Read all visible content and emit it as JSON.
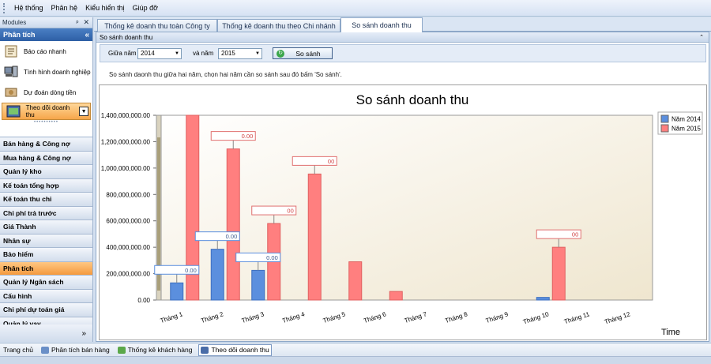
{
  "menu": [
    "Hệ thống",
    "Phân hệ",
    "Kiểu hiển thị",
    "Giúp đỡ"
  ],
  "modules": {
    "title": "Modules",
    "pin": "ᵖ",
    "close": "✕",
    "section": "Phân tích",
    "collapse": "«",
    "items": [
      {
        "label": "Báo cáo nhanh",
        "icon": "report-icon"
      },
      {
        "label": "Tình hình doanh nghiệp",
        "icon": "computer-icon"
      },
      {
        "label": "Dự đoán dòng tiền",
        "icon": "money-icon"
      },
      {
        "label": "Theo dõi doanh thu",
        "icon": "revenue-icon",
        "selected": true
      }
    ],
    "groups": [
      "Bán hàng & Công nợ",
      "Mua hàng & Công nợ",
      "Quản lý kho",
      "Kế toán tổng hợp",
      "Kế toán thu chi",
      "Chi phí trả trước",
      "Giá Thành",
      "Nhân sự",
      "Bảo hiểm",
      "Phân tích",
      "Quản lý Ngân sách",
      "Cấu hình",
      "Chi phí dự toán giá",
      "Quản lý vay"
    ],
    "active_group": "Phân tích",
    "footer_icon": "»"
  },
  "tabs": [
    {
      "label": "Thống kê doanh thu toàn Công ty",
      "active": false
    },
    {
      "label": "Thống kê doanh thu theo Chi nhánh",
      "active": false
    },
    {
      "label": "So sánh doanh thu",
      "active": true
    }
  ],
  "panel": {
    "title": "So sánh doanh thu",
    "collapse": "⌃",
    "from_label": "Giữa năm",
    "from_value": "2014",
    "to_label": "và năm",
    "to_value": "2015",
    "compare_button": "So sánh",
    "note": "So sánh daonh thu giữa hai năm, chọn hai năm cần so sánh sau đó bấm 'So sánh'."
  },
  "chart_data": {
    "type": "bar",
    "title": "So sánh doanh thu",
    "xlabel": "Time",
    "ylabel": "",
    "categories": [
      "Tháng 1",
      "Tháng 2",
      "Tháng 3",
      "Tháng 4",
      "Tháng 5",
      "Tháng 6",
      "Tháng 7",
      "Tháng 8",
      "Tháng 9",
      "Tháng 10",
      "Tháng 11",
      "Tháng 12"
    ],
    "series": [
      {
        "name": "Năm 2014",
        "color": "#5b8fde",
        "values": [
          130000000,
          385000000,
          225000000,
          0,
          0,
          0,
          0,
          0,
          0,
          20000000,
          0,
          0
        ]
      },
      {
        "name": "Năm 2015",
        "color": "#ff7f7f",
        "values": [
          1400000000,
          1145000000,
          580000000,
          955000000,
          290000000,
          65000000,
          0,
          0,
          0,
          400000000,
          0,
          0
        ]
      }
    ],
    "ylim": [
      0,
      1400000000
    ],
    "yticks": [
      "0.00",
      "200,000,000.00",
      "400,000,000.00",
      "600,000,000.00",
      "800,000,000.00",
      "1,000,000,000.00",
      "1,200,000,000.00",
      "1,400,000,000.00"
    ],
    "data_labels": [
      {
        "series": 0,
        "cat": 0,
        "text": "0.00"
      },
      {
        "series": 0,
        "cat": 1,
        "text": "0.00"
      },
      {
        "series": 0,
        "cat": 2,
        "text": "0.00"
      },
      {
        "series": 1,
        "cat": 1,
        "text": "0.00"
      },
      {
        "series": 1,
        "cat": 3,
        "text": "00"
      },
      {
        "series": 1,
        "cat": 2,
        "text": "00"
      },
      {
        "series": 1,
        "cat": 9,
        "text": "00"
      }
    ],
    "legend": "top-right",
    "grid": false
  },
  "statusbar": [
    {
      "label": "Trang chủ",
      "icon": "",
      "selected": false
    },
    {
      "label": "Phân tích bán hàng",
      "icon": "chart-icon",
      "selected": false
    },
    {
      "label": "Thống kê khách hàng",
      "icon": "customers-icon",
      "selected": false
    },
    {
      "label": "Theo dõi doanh thu",
      "icon": "revenue-icon",
      "selected": true
    }
  ]
}
